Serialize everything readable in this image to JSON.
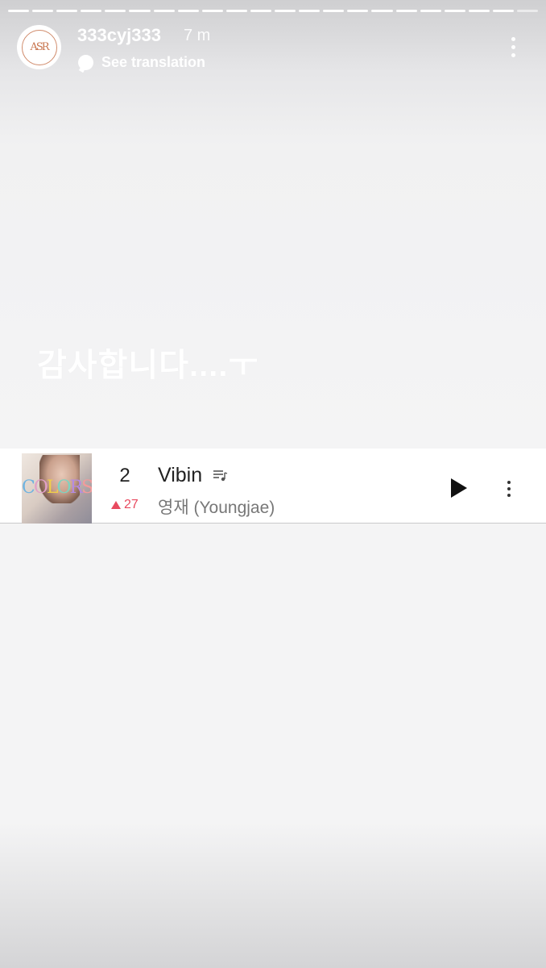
{
  "story": {
    "segments": 22,
    "username": "333cyj333",
    "time": "7 m",
    "translate_label": "See translation",
    "avatar_logo": "ASR",
    "more_icon": "more-vertical-icon",
    "caption": "감사합니다....ㅜ"
  },
  "song": {
    "album_title": "COLORS",
    "rank": "2",
    "rank_change": "27",
    "rank_change_direction": "up",
    "title": "Vibin",
    "artist": "영재 (Youngjae)",
    "icons": {
      "lyrics": "lyrics-icon",
      "play": "play-icon",
      "more": "more-vertical-icon"
    }
  },
  "colors": {
    "rank_up": "#e84a5f",
    "text_primary": "#222222",
    "text_secondary": "#777777"
  }
}
